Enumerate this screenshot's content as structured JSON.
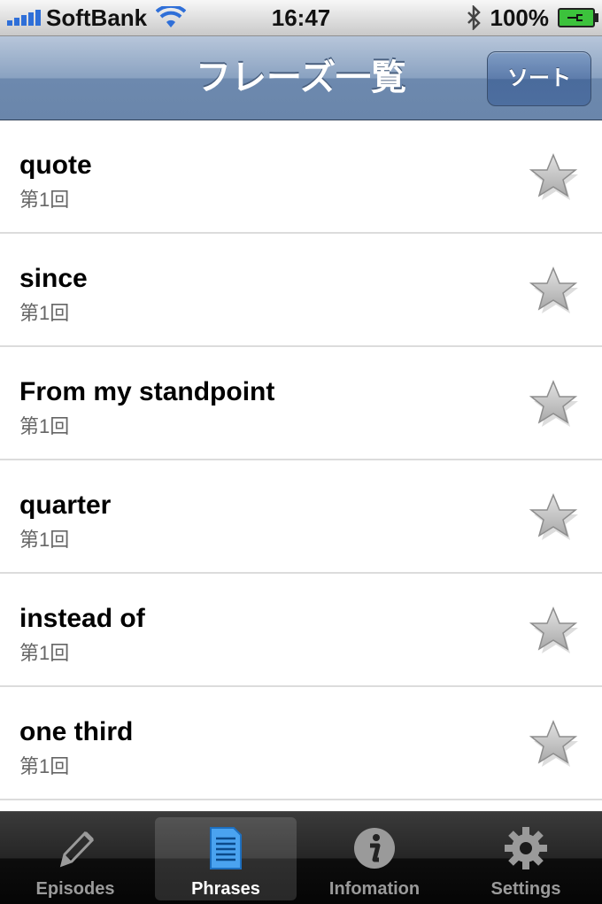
{
  "status_bar": {
    "carrier": "SoftBank",
    "time": "16:47",
    "battery": "100%"
  },
  "nav": {
    "title": "フレーズ一覧",
    "sort_label": "ソート"
  },
  "phrases": [
    {
      "text": "quote",
      "episode": "第1回"
    },
    {
      "text": "since",
      "episode": "第1回"
    },
    {
      "text": "From my standpoint",
      "episode": "第1回"
    },
    {
      "text": "quarter",
      "episode": "第1回"
    },
    {
      "text": "instead of",
      "episode": "第1回"
    },
    {
      "text": "one third",
      "episode": "第1回"
    }
  ],
  "tabs": [
    {
      "label": "Episodes",
      "icon": "pencil-icon",
      "selected": false
    },
    {
      "label": "Phrases",
      "icon": "document-icon",
      "selected": true
    },
    {
      "label": "Infomation",
      "icon": "info-icon",
      "selected": false
    },
    {
      "label": "Settings",
      "icon": "gear-icon",
      "selected": false
    }
  ],
  "colors": {
    "nav_bar": "#7d96b8",
    "tab_selected_icon": "#4aa3f0",
    "star_fill": "#c8c8c8",
    "battery": "#3cc23c",
    "signal": "#2f6fd8"
  }
}
